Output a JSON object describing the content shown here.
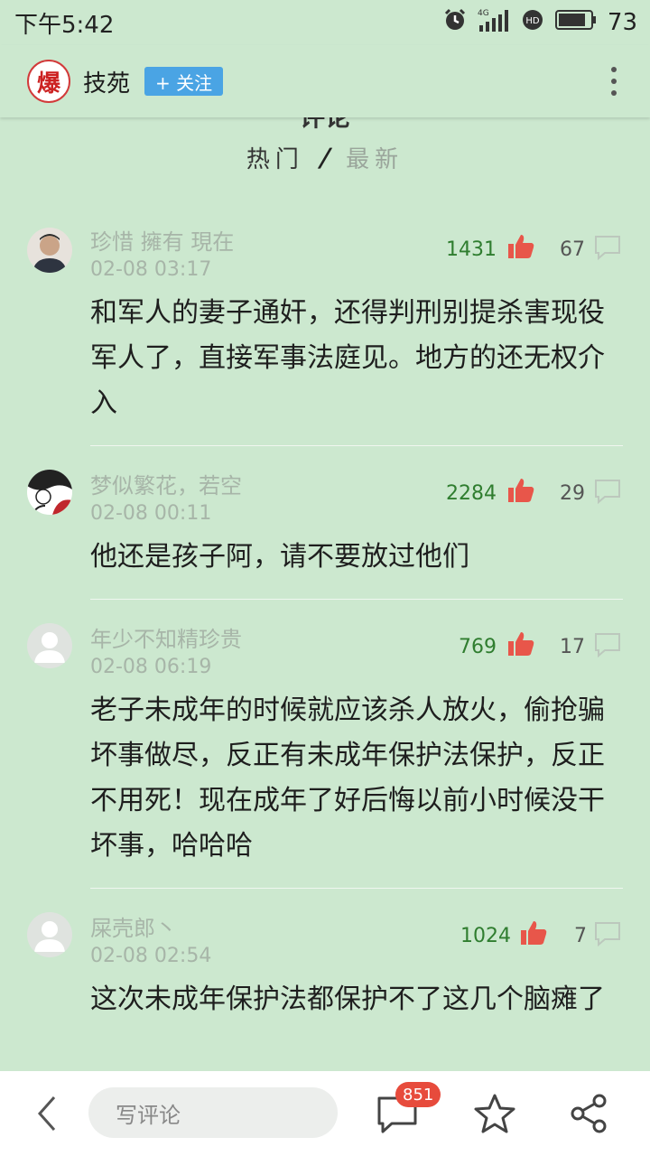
{
  "status_bar": {
    "time": "下午5:42",
    "network": "4G",
    "hd": "HD",
    "battery": "73"
  },
  "header": {
    "logo_char": "爆",
    "channel_name": "技苑",
    "follow_label": "+ 关注",
    "more_icon": "more-vertical-icon"
  },
  "hidden_title": "评论",
  "sort_tabs": {
    "hot": "热门",
    "new": "最新"
  },
  "comments": [
    {
      "user": "珍惜 擁有 現在",
      "time": "02-08 03:17",
      "likes": "1431",
      "replies": "67",
      "text": "和军人的妻子通奸，还得判刑别提杀害现役军人了，直接军事法庭见。地方的还无权介入"
    },
    {
      "user": "梦似繁花，若空",
      "time": "02-08 00:11",
      "likes": "2284",
      "replies": "29",
      "text": "他还是孩子阿，请不要放过他们"
    },
    {
      "user": "年少不知精珍贵",
      "time": "02-08 06:19",
      "likes": "769",
      "replies": "17",
      "text": "老子未成年的时候就应该杀人放火，偷抢骗坏事做尽，反正有未成年保护法保护，反正不用死！现在成年了好后悔以前小时候没干坏事，哈哈哈"
    },
    {
      "user": "屎壳郎丶",
      "time": "02-08 02:54",
      "likes": "1024",
      "replies": "7",
      "text": "这次未成年保护法都保护不了这几个脑瘫了"
    }
  ],
  "bottom_bar": {
    "comment_placeholder": "写评论",
    "comment_count": "851"
  },
  "colors": {
    "background": "#cce8cf",
    "like_icon": "#e8564a",
    "like_count": "#2f7d2f",
    "badge": "#e74b3c",
    "follow_button": "#4aa4e4"
  }
}
